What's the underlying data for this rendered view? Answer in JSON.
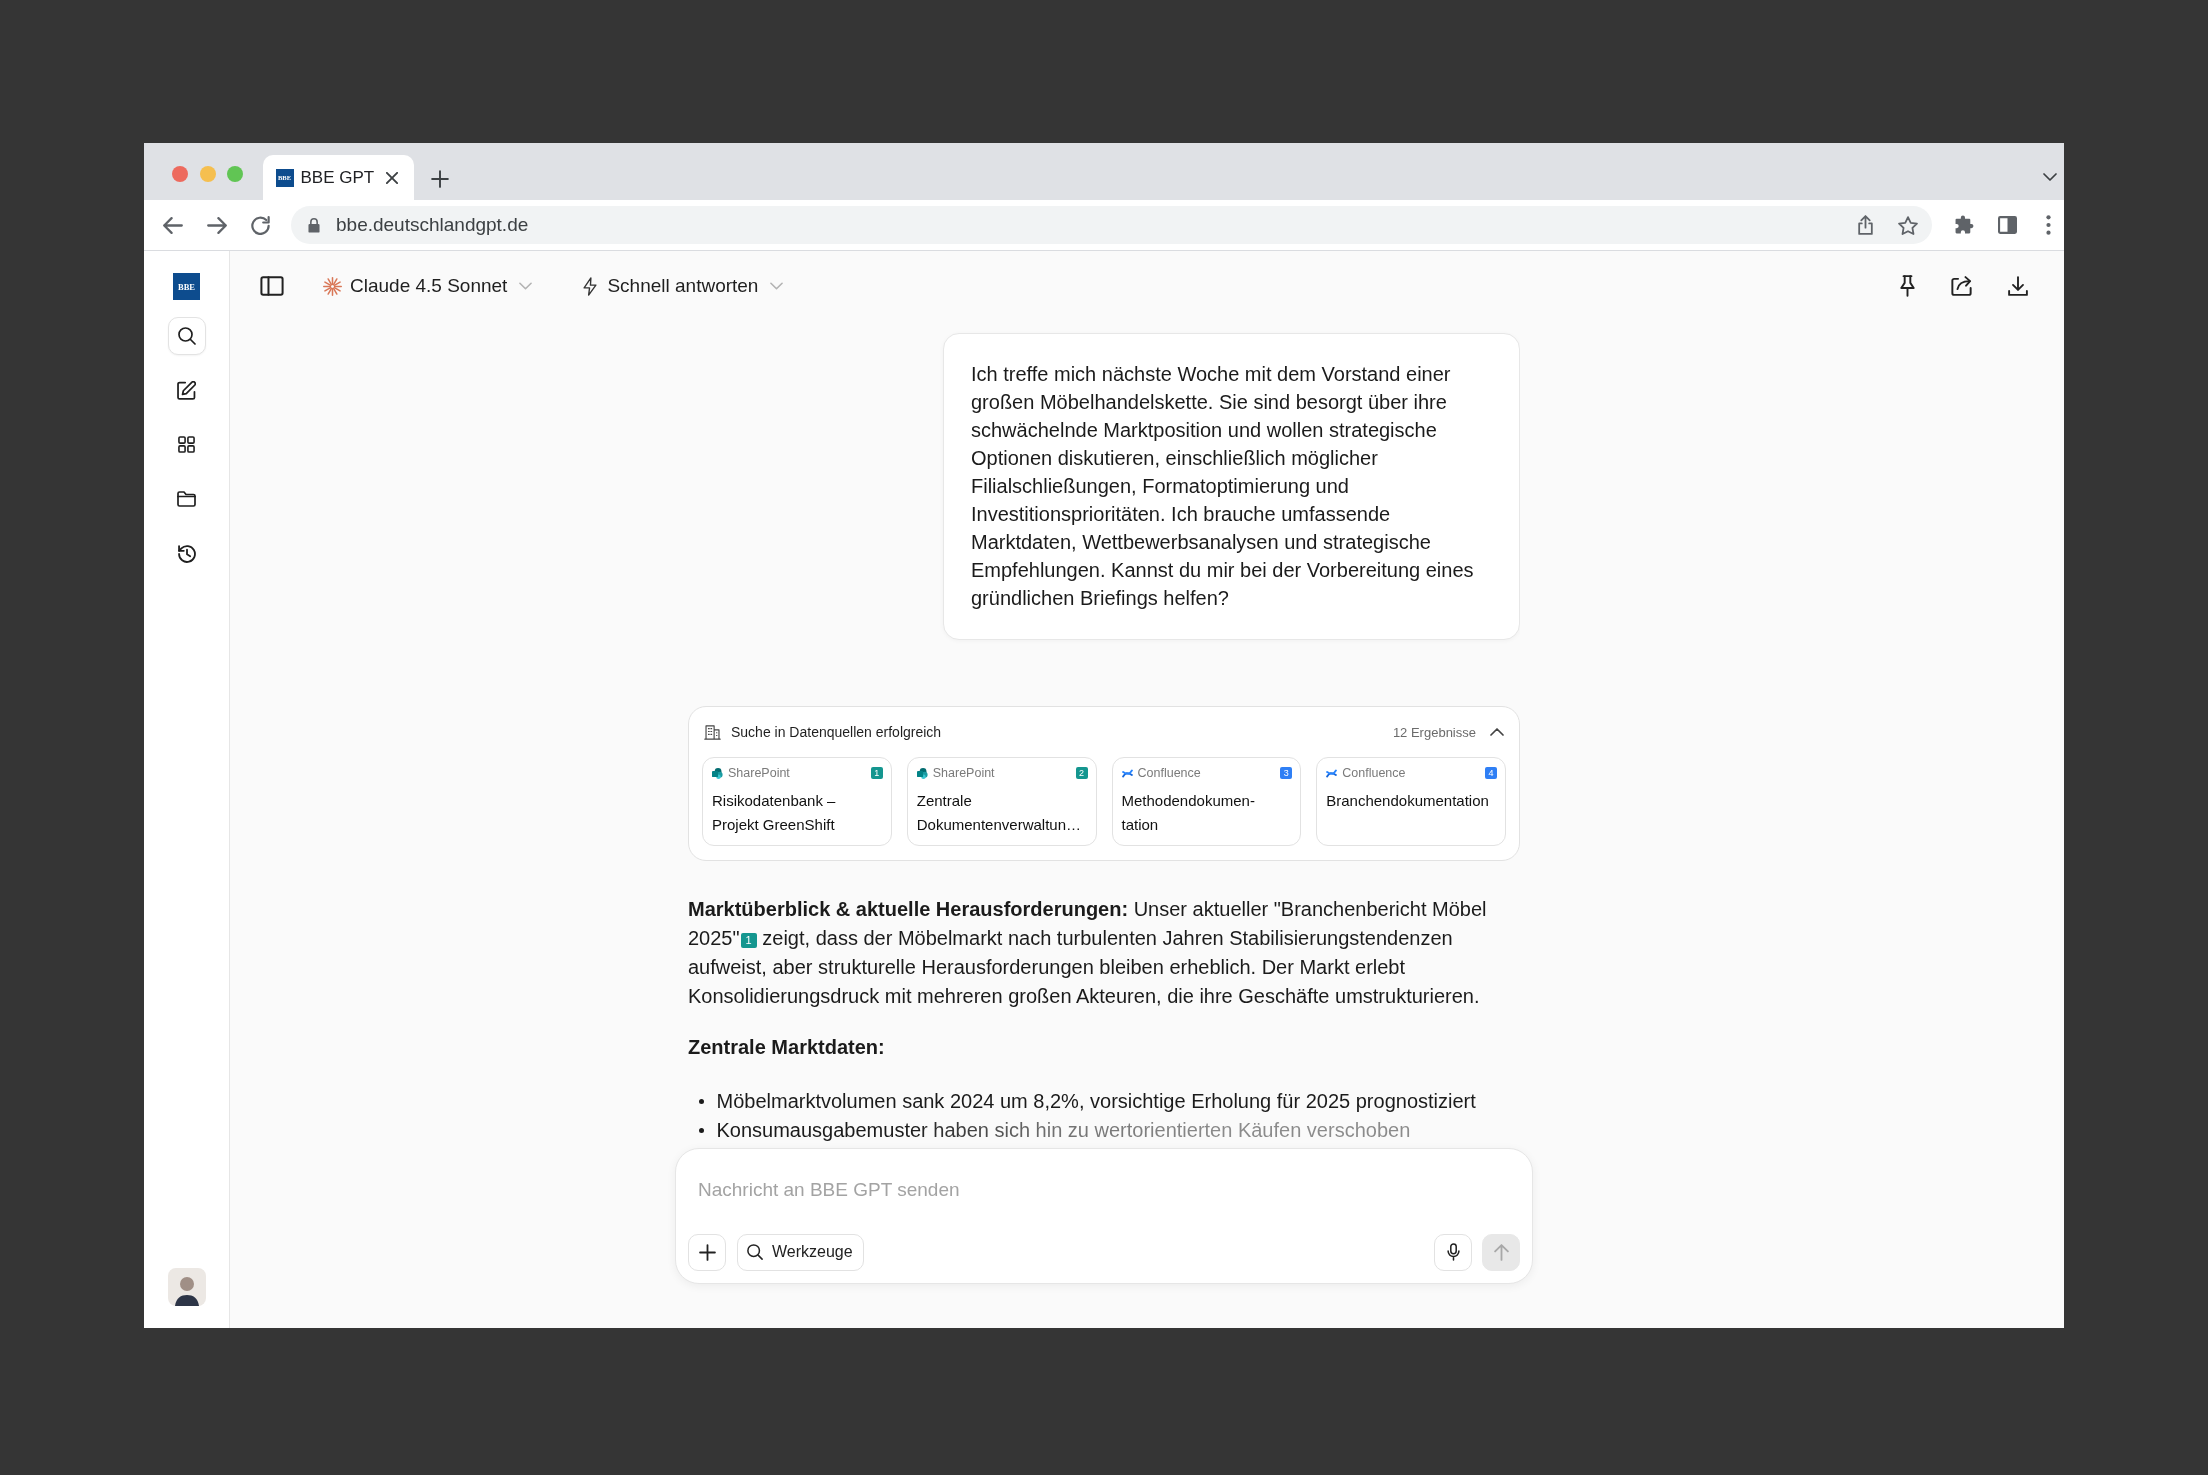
{
  "browser": {
    "tabs": [
      {
        "title": "BBE GPT",
        "favicon": "BBE",
        "selected": true
      }
    ],
    "url": "bbe.deutschlandgpt.de"
  },
  "sidebar": {
    "logo": "BBE",
    "items": [
      {
        "kind": "search",
        "selected": true
      },
      {
        "kind": "new_chat",
        "selected": false
      },
      {
        "kind": "apps",
        "selected": false
      },
      {
        "kind": "folder",
        "selected": false
      },
      {
        "kind": "history",
        "selected": false
      }
    ]
  },
  "toolbar": {
    "model": "Claude 4.5 Sonnet",
    "mode": "Schnell antworten",
    "actions": [
      {
        "kind": "pin"
      },
      {
        "kind": "share"
      },
      {
        "kind": "download"
      }
    ]
  },
  "user_message": "Ich treffe mich nächste Woche mit dem Vorstand einer großen Möbelhandelskette. Sie sind besorgt über ihre schwächelnde Marktposition und wollen strategische Optionen diskutieren, einschließlich möglicher Filialschließungen, Formatoptimierung und Investitionsprioritäten. Ich brauche umfassende Marktdaten, Wettbewerbsanalysen und strategische Empfehlungen. Kannst du mir bei der Vorbereitung eines gründlichen Briefings helfen?",
  "search_results": {
    "title": "Suche in Datenquellen erfolgreich",
    "count": "12 Ergebnisse",
    "expanded": true,
    "sources": [
      {
        "kind": "sharepoint",
        "source": "SharePoint",
        "number": "1",
        "title": "Risikodatenbank – Projekt GreenShift"
      },
      {
        "kind": "sharepoint",
        "source": "SharePoint",
        "number": "2",
        "title": "Zentrale Dokumentenverwaltun…"
      },
      {
        "kind": "confluence",
        "source": "Confluence",
        "number": "3",
        "title": "Methodendokumen-tation"
      },
      {
        "kind": "confluence",
        "source": "Confluence",
        "number": "4",
        "title": "Branchendokumentation"
      }
    ]
  },
  "answer": {
    "paragraph": [
      {
        "kind": "text",
        "text": "**Marktüberblick & aktuelle Herausforderungen:** Unser aktueller \"Branchenbericht Möbel 2025\""
      },
      {
        "kind": "citation",
        "label": "1",
        "color": "#14968f"
      },
      {
        "kind": "text",
        "text": " zeigt, dass der Möbelmarkt nach turbulenten Jahren Stabilisierungstendenzen aufweist, aber strukturelle Herausforderungen bleiben erheblich. Der Markt erlebt Konsolidierungsdruck mit mehreren großen Akteuren, die ihre Geschäfte umstrukturieren."
      }
    ],
    "heading": "Zentrale Marktdaten:",
    "bullets": [
      {
        "text": "Möbelmarktvolumen sank 2024 um 8,2%, vorsichtige Erholung für 2025 prognostiziert",
        "faded": false
      },
      {
        "text": "Konsumausgabemuster haben sich hin zu wertorientierten Käufen verschoben",
        "faded": true
      }
    ]
  },
  "composer": {
    "placeholder": "Nachricht an BBE GPT senden",
    "tools": "Werkzeuge",
    "send": {
      "disabled": true
    }
  }
}
